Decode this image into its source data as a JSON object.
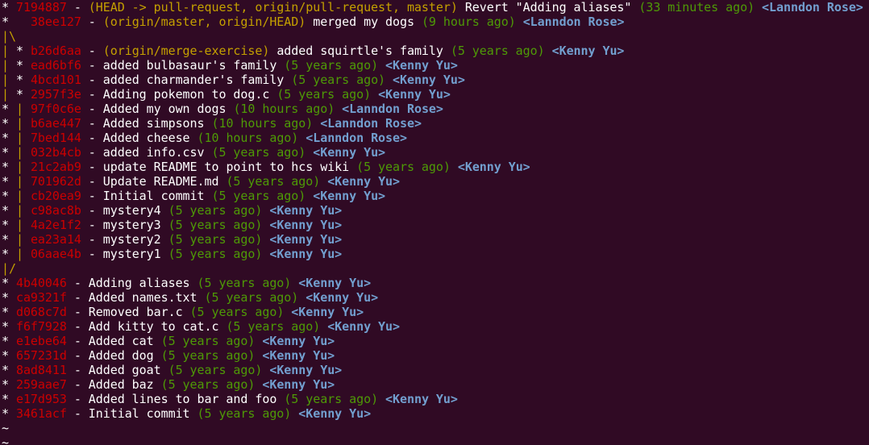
{
  "colors": {
    "background": "#300a24",
    "hash": "#cc0000",
    "refs": "#c4a000",
    "date": "#4e9a06",
    "author": "#729fcf",
    "text": "#ffffff"
  },
  "log": [
    {
      "kind": "commit",
      "graph": "* ",
      "hash": "7194887",
      "refs": "(HEAD -> pull-request, origin/pull-request, master)",
      "message": "Revert \"Adding aliases\"",
      "date": "(33 minutes ago)",
      "author": "<Lanndon Rose>"
    },
    {
      "kind": "commit",
      "graph": "*   ",
      "hash": "38ee127",
      "refs": "(origin/master, origin/HEAD)",
      "message": "merged my dogs",
      "date": "(9 hours ago)",
      "author": "<Lanndon Rose>"
    },
    {
      "kind": "graph",
      "graph": "|\\"
    },
    {
      "kind": "commit",
      "graph": "| * ",
      "hash": "b26d6aa",
      "refs": "(origin/merge-exercise)",
      "message": "added squirtle's family",
      "date": "(5 years ago)",
      "author": "<Kenny Yu>"
    },
    {
      "kind": "commit",
      "graph": "| * ",
      "hash": "ead6bf6",
      "refs": "",
      "message": "added bulbasaur's family",
      "date": "(5 years ago)",
      "author": "<Kenny Yu>"
    },
    {
      "kind": "commit",
      "graph": "| * ",
      "hash": "4bcd101",
      "refs": "",
      "message": "added charmander's family",
      "date": "(5 years ago)",
      "author": "<Kenny Yu>"
    },
    {
      "kind": "commit",
      "graph": "| * ",
      "hash": "2957f3e",
      "refs": "",
      "message": "Adding pokemon to dog.c",
      "date": "(5 years ago)",
      "author": "<Kenny Yu>"
    },
    {
      "kind": "commit",
      "graph": "* | ",
      "hash": "97f0c6e",
      "refs": "",
      "message": "Added my own dogs",
      "date": "(10 hours ago)",
      "author": "<Lanndon Rose>"
    },
    {
      "kind": "commit",
      "graph": "* | ",
      "hash": "b6ae447",
      "refs": "",
      "message": "Added simpsons",
      "date": "(10 hours ago)",
      "author": "<Lanndon Rose>"
    },
    {
      "kind": "commit",
      "graph": "* | ",
      "hash": "7bed144",
      "refs": "",
      "message": "Added cheese",
      "date": "(10 hours ago)",
      "author": "<Lanndon Rose>"
    },
    {
      "kind": "commit",
      "graph": "* | ",
      "hash": "032b4cb",
      "refs": "",
      "message": "added info.csv",
      "date": "(5 years ago)",
      "author": "<Kenny Yu>"
    },
    {
      "kind": "commit",
      "graph": "* | ",
      "hash": "21c2ab9",
      "refs": "",
      "message": "update README to point to hcs wiki",
      "date": "(5 years ago)",
      "author": "<Kenny Yu>"
    },
    {
      "kind": "commit",
      "graph": "* | ",
      "hash": "701962d",
      "refs": "",
      "message": "Update README.md",
      "date": "(5 years ago)",
      "author": "<Kenny Yu>"
    },
    {
      "kind": "commit",
      "graph": "* | ",
      "hash": "cb20ea9",
      "refs": "",
      "message": "Initial commit",
      "date": "(5 years ago)",
      "author": "<Kenny Yu>"
    },
    {
      "kind": "commit",
      "graph": "* | ",
      "hash": "c98ac8b",
      "refs": "",
      "message": "mystery4",
      "date": "(5 years ago)",
      "author": "<Kenny Yu>"
    },
    {
      "kind": "commit",
      "graph": "* | ",
      "hash": "4a2e1f2",
      "refs": "",
      "message": "mystery3",
      "date": "(5 years ago)",
      "author": "<Kenny Yu>"
    },
    {
      "kind": "commit",
      "graph": "* | ",
      "hash": "ea23a14",
      "refs": "",
      "message": "mystery2",
      "date": "(5 years ago)",
      "author": "<Kenny Yu>"
    },
    {
      "kind": "commit",
      "graph": "* | ",
      "hash": "06aae4b",
      "refs": "",
      "message": "mystery1",
      "date": "(5 years ago)",
      "author": "<Kenny Yu>"
    },
    {
      "kind": "graph",
      "graph": "|/"
    },
    {
      "kind": "commit",
      "graph": "* ",
      "hash": "4b40046",
      "refs": "",
      "message": "Adding aliases",
      "date": "(5 years ago)",
      "author": "<Kenny Yu>"
    },
    {
      "kind": "commit",
      "graph": "* ",
      "hash": "ca9321f",
      "refs": "",
      "message": "Added names.txt",
      "date": "(5 years ago)",
      "author": "<Kenny Yu>"
    },
    {
      "kind": "commit",
      "graph": "* ",
      "hash": "d068c7d",
      "refs": "",
      "message": "Removed bar.c",
      "date": "(5 years ago)",
      "author": "<Kenny Yu>"
    },
    {
      "kind": "commit",
      "graph": "* ",
      "hash": "f6f7928",
      "refs": "",
      "message": "Add kitty to cat.c",
      "date": "(5 years ago)",
      "author": "<Kenny Yu>"
    },
    {
      "kind": "commit",
      "graph": "* ",
      "hash": "e1ebe64",
      "refs": "",
      "message": "Added cat",
      "date": "(5 years ago)",
      "author": "<Kenny Yu>"
    },
    {
      "kind": "commit",
      "graph": "* ",
      "hash": "657231d",
      "refs": "",
      "message": "Added dog",
      "date": "(5 years ago)",
      "author": "<Kenny Yu>"
    },
    {
      "kind": "commit",
      "graph": "* ",
      "hash": "8ad8411",
      "refs": "",
      "message": "Added goat",
      "date": "(5 years ago)",
      "author": "<Kenny Yu>"
    },
    {
      "kind": "commit",
      "graph": "* ",
      "hash": "259aae7",
      "refs": "",
      "message": "Added baz",
      "date": "(5 years ago)",
      "author": "<Kenny Yu>"
    },
    {
      "kind": "commit",
      "graph": "* ",
      "hash": "e17d953",
      "refs": "",
      "message": "Added lines to bar and foo",
      "date": "(5 years ago)",
      "author": "<Kenny Yu>"
    },
    {
      "kind": "commit",
      "graph": "* ",
      "hash": "3461acf",
      "refs": "",
      "message": "Initial commit",
      "date": "(5 years ago)",
      "author": "<Kenny Yu>"
    }
  ],
  "pager_tildes": [
    "~",
    "~"
  ]
}
